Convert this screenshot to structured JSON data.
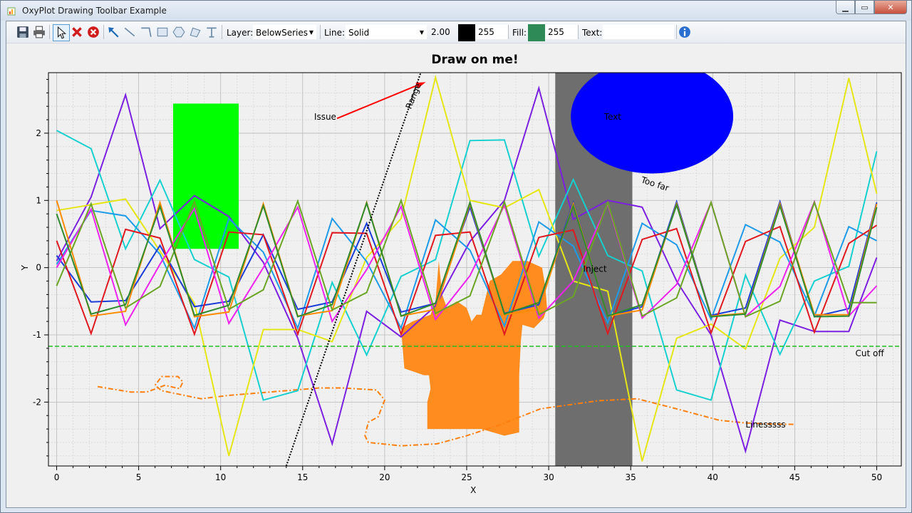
{
  "window": {
    "title": "OxyPlot Drawing Toolbar Example",
    "minimize_icon": "minimize-icon",
    "maximize_icon": "maximize-icon",
    "close_icon": "close-icon"
  },
  "toolbar": {
    "icons": [
      "save-icon",
      "print-icon",
      "select-icon",
      "delete-icon",
      "delete-all-icon",
      "arrow-tool-icon",
      "line-tool-icon",
      "polyline-tool-icon",
      "rectangle-tool-icon",
      "ellipse-tool-icon",
      "polygon-tool-icon",
      "text-tool-icon"
    ],
    "layer_label": "Layer:",
    "layer_value": "BelowSeries",
    "line_label": "Line:",
    "line_value": "Solid",
    "line_thickness": "2.00",
    "line_color": "#000000",
    "line_alpha": "255",
    "fill_label": "Fill:",
    "fill_color": "#2e8b57",
    "fill_alpha": "255",
    "text_label": "Text:",
    "text_value": "",
    "info_icon": "info-icon"
  },
  "chart_data": {
    "type": "line",
    "title": "Draw on me!",
    "xlabel": "X",
    "ylabel": "Y",
    "xlim": [
      -0.5,
      51.5
    ],
    "ylim": [
      -2.95,
      2.9
    ],
    "xticks": [
      "0",
      "5",
      "10",
      "15",
      "20",
      "25",
      "30",
      "35",
      "40",
      "45",
      "50"
    ],
    "yticks": [
      "-2",
      "-1",
      "0",
      "1",
      "2"
    ],
    "grid": true,
    "series": [
      {
        "color": "#7b1fe0",
        "x": [
          0,
          2.1,
          4.2,
          6.3,
          8.4,
          10.5,
          12.6,
          14.7,
          16.8,
          18.9,
          21,
          23.1,
          25.2,
          27.3,
          29.4,
          31.5,
          33.6,
          35.7,
          37.8,
          39.9,
          42,
          44.1,
          46.2,
          48.3,
          50
        ],
        "values": [
          0.1,
          1.05,
          2.57,
          0.58,
          1.07,
          0.76,
          0.08,
          -1.05,
          -2.62,
          -0.65,
          -1.03,
          -0.57,
          0.39,
          1.0,
          2.67,
          0.72,
          1.0,
          0.9,
          -0.2,
          -1.0,
          -2.73,
          -0.78,
          -0.95,
          -0.95,
          0.15
        ]
      },
      {
        "color": "#16d0d0",
        "x": [
          0,
          2.1,
          4.2,
          6.3,
          8.4,
          10.5,
          12.6,
          14.7,
          16.8,
          18.9,
          21,
          23.1,
          25.2,
          27.3,
          29.4,
          31.5,
          33.6,
          35.7,
          37.8,
          39.9,
          42,
          44.1,
          46.2,
          48.3,
          50
        ],
        "values": [
          2.04,
          1.77,
          0.28,
          1.3,
          0.12,
          -0.14,
          -1.97,
          -1.83,
          -0.22,
          -1.3,
          -0.13,
          0.12,
          1.89,
          1.9,
          0.17,
          1.31,
          0.18,
          -0.05,
          -1.82,
          -1.97,
          -0.11,
          -1.29,
          -0.2,
          0.02,
          1.73
        ]
      },
      {
        "color": "#e6e617",
        "x": [
          0,
          4.2,
          8.4,
          10.5,
          12.6,
          14.7,
          16.8,
          18.9,
          21,
          23.1,
          25.2,
          27.3,
          29.4,
          31.5,
          33.6,
          35.7,
          37.8,
          39.9,
          42,
          44.1,
          46.2,
          48.3,
          50
        ],
        "values": [
          0.85,
          1.02,
          -0.53,
          -2.8,
          -0.92,
          -0.92,
          -1.1,
          0.15,
          0.73,
          2.83,
          1.0,
          0.89,
          1.16,
          -0.2,
          -0.35,
          -2.88,
          -1.05,
          -0.84,
          -1.21,
          0.14,
          0.6,
          2.82,
          1.1
        ]
      },
      {
        "color": "#1e9be8",
        "x": [
          0,
          2.1,
          4.2,
          6.3,
          8.4,
          10.5,
          12.6,
          14.7,
          16.8,
          18.9,
          21,
          23.1,
          25.2,
          27.3,
          29.4,
          31.5,
          33.6,
          35.7,
          37.8,
          39.9,
          42,
          44.1,
          46.2,
          48.3,
          50
        ],
        "values": [
          0.05,
          0.85,
          0.77,
          0.2,
          -0.9,
          0.73,
          0.23,
          -0.9,
          0.73,
          0.09,
          -0.9,
          0.71,
          0.26,
          -0.87,
          0.68,
          0.32,
          -0.82,
          0.66,
          0.34,
          -0.77,
          0.64,
          0.38,
          -0.72,
          0.61,
          0.4
        ]
      },
      {
        "color": "#1a3cd8",
        "x": [
          0,
          2.1,
          4.2,
          6.3,
          8.4,
          10.5,
          12.6,
          14.7,
          16.8,
          18.9,
          21,
          23.1,
          25.2,
          27.3,
          29.4,
          31.5,
          33.6,
          35.7,
          37.8,
          39.9,
          42,
          44.1,
          46.2,
          48.3,
          50
        ],
        "values": [
          0.18,
          -0.51,
          -0.49,
          0.33,
          -0.58,
          -0.5,
          0.49,
          -0.62,
          -0.51,
          0.66,
          -0.66,
          -0.53,
          0.9,
          -0.68,
          -0.55,
          0.97,
          -0.72,
          -0.58,
          0.98,
          -0.71,
          -0.6,
          0.98,
          -0.73,
          -0.61,
          0.97
        ]
      },
      {
        "color": "#e0181f",
        "x": [
          0,
          2.1,
          4.2,
          6.3,
          8.4,
          10.5,
          12.6,
          14.7,
          16.8,
          18.9,
          21,
          23.1,
          25.2,
          27.3,
          29.4,
          31.5,
          33.6,
          35.7,
          37.8,
          39.9,
          42,
          44.1,
          46.2,
          48.3,
          50
        ],
        "values": [
          0.4,
          -0.98,
          0.57,
          0.44,
          -0.99,
          0.53,
          0.49,
          -0.99,
          0.52,
          0.51,
          -0.99,
          0.48,
          0.53,
          -0.99,
          0.45,
          0.56,
          -0.98,
          0.42,
          0.58,
          -0.97,
          0.39,
          0.61,
          -0.96,
          0.36,
          0.63
        ]
      },
      {
        "color": "#ee22ee",
        "x": [
          0,
          2.1,
          4.2,
          6.3,
          8.4,
          10.5,
          12.6,
          14.7,
          16.8,
          18.9,
          21,
          23.1,
          25.2,
          27.3,
          29.4,
          31.5,
          33.6,
          35.7,
          37.8,
          39.9,
          42,
          44.1,
          46.2,
          48.3,
          50
        ],
        "values": [
          0.0,
          0.87,
          -0.85,
          0.05,
          0.88,
          -0.83,
          0.0,
          0.9,
          -0.8,
          -0.03,
          0.91,
          -0.77,
          -0.12,
          0.93,
          -0.75,
          -0.2,
          0.95,
          -0.75,
          -0.25,
          0.97,
          -0.73,
          -0.28,
          0.98,
          -0.72,
          -0.27
        ]
      },
      {
        "color": "#ff8c00",
        "x": [
          0,
          2.1,
          4.2,
          6.3,
          8.4,
          10.5,
          12.6,
          14.7,
          16.8,
          18.9,
          21,
          23.1,
          25.2,
          27.3,
          29.4,
          31.5,
          33.6,
          35.7,
          37.8,
          39.9,
          42,
          44.1,
          46.2,
          48.3,
          50
        ],
        "values": [
          1.0,
          -0.72,
          -0.65,
          0.97,
          -0.73,
          -0.66,
          0.95,
          -0.72,
          -0.64,
          0.97,
          -0.72,
          -0.62,
          0.95,
          -0.7,
          -0.62,
          0.95,
          -0.72,
          -0.63,
          0.95,
          -0.72,
          -0.68,
          0.95,
          -0.7,
          -0.7,
          0.95
        ]
      },
      {
        "color": "#6aa524",
        "x": [
          0,
          2.1,
          4.2,
          6.3,
          8.4,
          10.5,
          12.6,
          14.7,
          16.8,
          18.9,
          21,
          23.1,
          25.2,
          27.3,
          29.4,
          31.5,
          33.6,
          35.7,
          37.8,
          39.9,
          42,
          44.1,
          46.2,
          48.3,
          50
        ],
        "values": [
          -0.27,
          0.95,
          -0.6,
          -0.28,
          0.98,
          -0.62,
          -0.33,
          0.99,
          -0.63,
          -0.37,
          1.0,
          -0.68,
          -0.42,
          0.98,
          -0.7,
          -0.43,
          0.97,
          -0.72,
          -0.45,
          0.97,
          -0.73,
          -0.5,
          0.97,
          -0.52,
          -0.52
        ]
      },
      {
        "color": "#2e8b2e",
        "x": [
          0,
          2.1,
          4.2,
          6.3,
          8.4,
          10.5,
          12.6,
          14.7,
          16.8,
          18.9,
          21,
          23.1,
          25.2,
          27.3,
          29.4,
          31.5,
          33.6,
          35.7,
          37.8,
          39.9,
          42,
          44.1,
          46.2,
          48.3,
          50
        ],
        "values": [
          0.8,
          -0.69,
          -0.55,
          0.91,
          -0.71,
          -0.56,
          0.92,
          -0.73,
          -0.55,
          0.96,
          -0.72,
          -0.53,
          0.97,
          -0.69,
          -0.52,
          0.92,
          -0.72,
          -0.55,
          0.93,
          -0.73,
          -0.69,
          0.92,
          -0.73,
          -0.72,
          0.9
        ]
      }
    ],
    "annotations": {
      "rect": {
        "color": "#00ff00",
        "x0": 7.1,
        "x1": 11.1,
        "y0": 0.28,
        "y1": 2.44
      },
      "band": {
        "color": "#6e6e6e",
        "x0": 30.4,
        "x1": 35.1,
        "label": "Inject"
      },
      "ellipse": {
        "color": "#0000ff",
        "cx": 36.3,
        "cy": 2.25,
        "rx": 4.95,
        "ry": 0.85,
        "label": "Text"
      },
      "arrow": {
        "color": "#ff0000",
        "label": "Issue",
        "from": [
          17.1,
          2.22
        ],
        "to": [
          22.5,
          2.76
        ]
      },
      "range_line": {
        "label": "Range",
        "from": [
          14.0,
          -2.95
        ],
        "to": [
          22.2,
          2.9
        ]
      },
      "hline": {
        "color": "#22bb22",
        "y": -1.17,
        "label": "Cut off"
      },
      "too_far": {
        "label": "Too far"
      },
      "lines_label": "Linesssss",
      "freehand_fill": "#ff8c1e",
      "freehand_line": "#ff7f0e"
    }
  }
}
